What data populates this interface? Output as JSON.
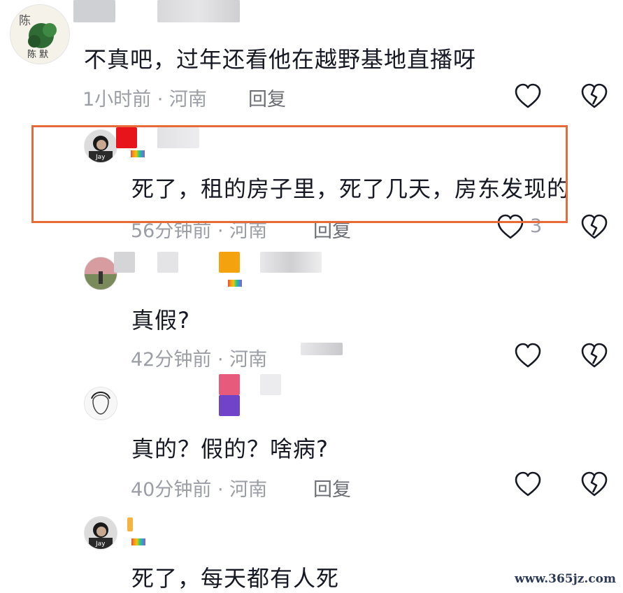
{
  "comments": [
    {
      "text": "不真吧，过年还看他在越野基地直播呀",
      "meta": "1小时前 · 河南",
      "reply_label": "回复",
      "avatar_text": "陈 默",
      "avatar_seal": "陈"
    },
    {
      "text": "死了，租的房子里，死了几天，房东发现的",
      "meta": "56分钟前 · 河南",
      "reply_label": "回复",
      "like_count": "3",
      "avatar_tag": "Jay"
    },
    {
      "text": "真假?",
      "meta": "42分钟前 · 河南"
    },
    {
      "text": "真的？假的？啥病?",
      "meta": "40分钟前 · 河南",
      "reply_label": "回复"
    },
    {
      "text": "死了，每天都有人死",
      "avatar_tag": "Jay"
    }
  ],
  "icons": {
    "like": "heart-icon",
    "dislike": "broken-heart-icon"
  },
  "colors": {
    "highlight_border": "#e86a3a",
    "meta_text": "#9c9ea6"
  },
  "watermark": "www.365jz.com"
}
